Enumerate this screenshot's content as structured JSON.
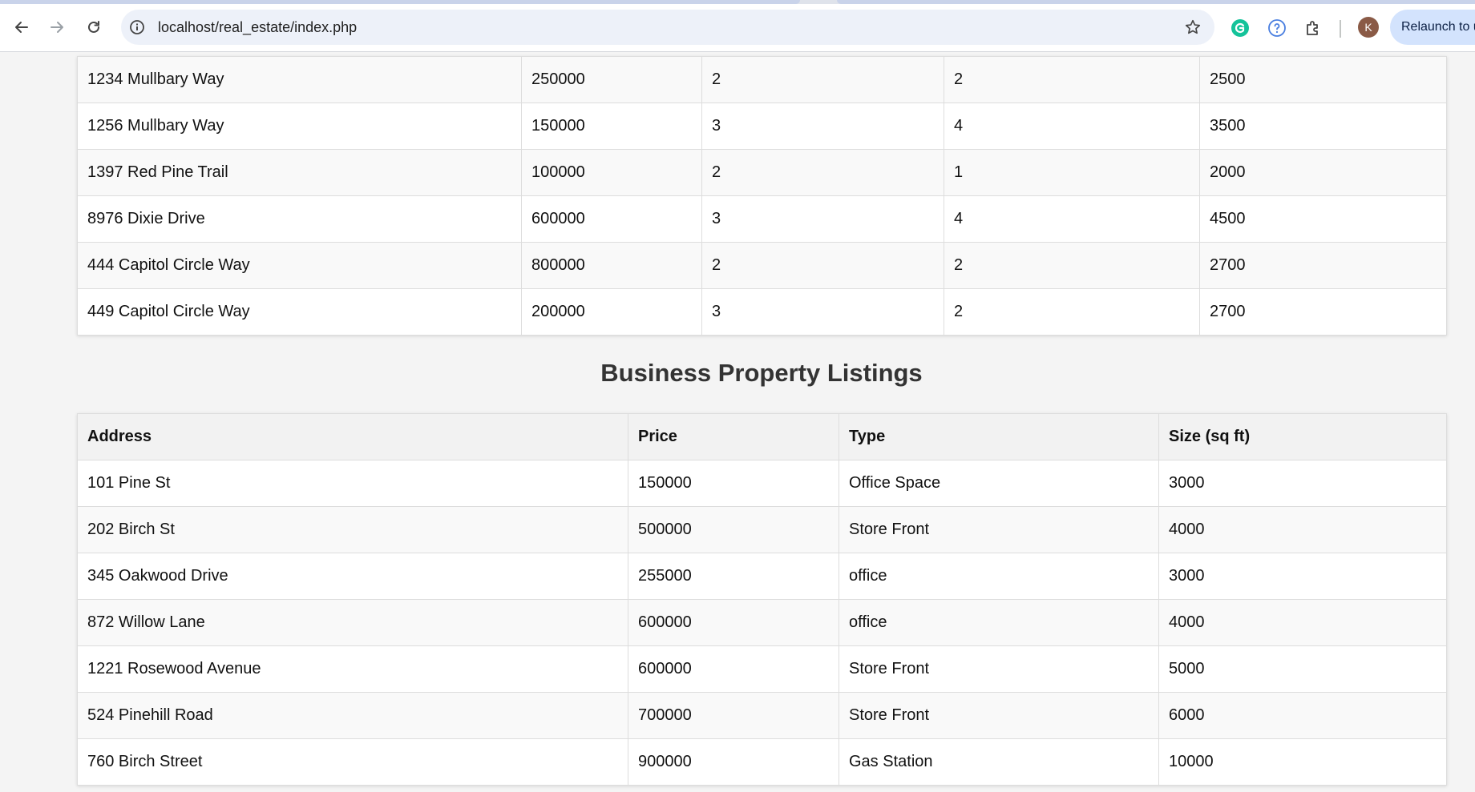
{
  "browser": {
    "url": "localhost/real_estate/index.php",
    "relaunch_label": "Relaunch to u",
    "avatar_initial": "K",
    "icons": {
      "back": "arrow-left-icon",
      "forward": "arrow-right-icon",
      "reload": "reload-icon",
      "site_info": "info-icon",
      "bookmark": "star-icon",
      "grammarly": "grammarly-icon",
      "help": "help-icon",
      "extensions": "puzzle-icon"
    }
  },
  "residential": {
    "rows": [
      [
        "1234 Mullbary Way",
        "250000",
        "2",
        "2",
        "2500"
      ],
      [
        "1256 Mullbary Way",
        "150000",
        "3",
        "4",
        "3500"
      ],
      [
        "1397 Red Pine Trail",
        "100000",
        "2",
        "1",
        "2000"
      ],
      [
        "8976 Dixie Drive",
        "600000",
        "3",
        "4",
        "4500"
      ],
      [
        "444 Capitol Circle Way",
        "800000",
        "2",
        "2",
        "2700"
      ],
      [
        "449 Capitol Circle Way",
        "200000",
        "3",
        "2",
        "2700"
      ]
    ]
  },
  "business": {
    "heading": "Business Property Listings",
    "headers": [
      "Address",
      "Price",
      "Type",
      "Size (sq ft)"
    ],
    "rows": [
      [
        "101 Pine St",
        "150000",
        "Office Space",
        "3000"
      ],
      [
        "202 Birch St",
        "500000",
        "Store Front",
        "4000"
      ],
      [
        "345 Oakwood Drive",
        "255000",
        "office",
        "3000"
      ],
      [
        "872 Willow Lane",
        "600000",
        "office",
        "4000"
      ],
      [
        "1221 Rosewood Avenue",
        "600000",
        "Store Front",
        "5000"
      ],
      [
        "524 Pinehill Road",
        "700000",
        "Store Front",
        "6000"
      ],
      [
        "760 Birch Street",
        "900000",
        "Gas Station",
        "10000"
      ]
    ]
  },
  "colors": {
    "page_bg": "#f4f4f4",
    "header_bg": "#f2f2f2",
    "alt_row_bg": "#f9f9f9",
    "border": "#dddddd",
    "heading": "#333333"
  }
}
